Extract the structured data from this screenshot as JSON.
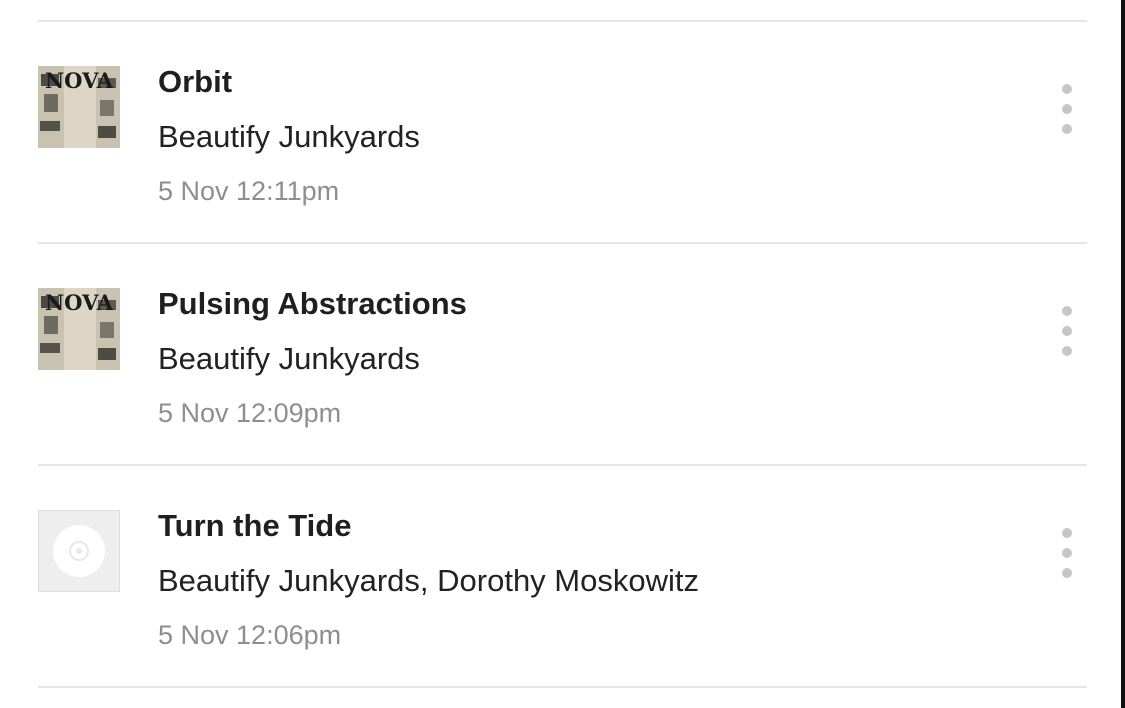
{
  "items": [
    {
      "title": "Orbit",
      "artist": "Beautify Junkyards",
      "time": "5 Nov 12:11pm",
      "art": "nova-album-art",
      "art_text": "NOVA"
    },
    {
      "title": "Pulsing Abstractions",
      "artist": "Beautify Junkyards",
      "time": "5 Nov 12:09pm",
      "art": "nova-album-art",
      "art_text": "NOVA"
    },
    {
      "title": "Turn the Tide",
      "artist": "Beautify Junkyards, Dorothy Moskowitz",
      "time": "5 Nov 12:06pm",
      "art": "disc-placeholder-icon"
    }
  ],
  "colors": {
    "divider": "#e6e6e6",
    "muted": "#8e8e8e",
    "title": "#1f1f1f",
    "menu": "#c6c6c6"
  }
}
